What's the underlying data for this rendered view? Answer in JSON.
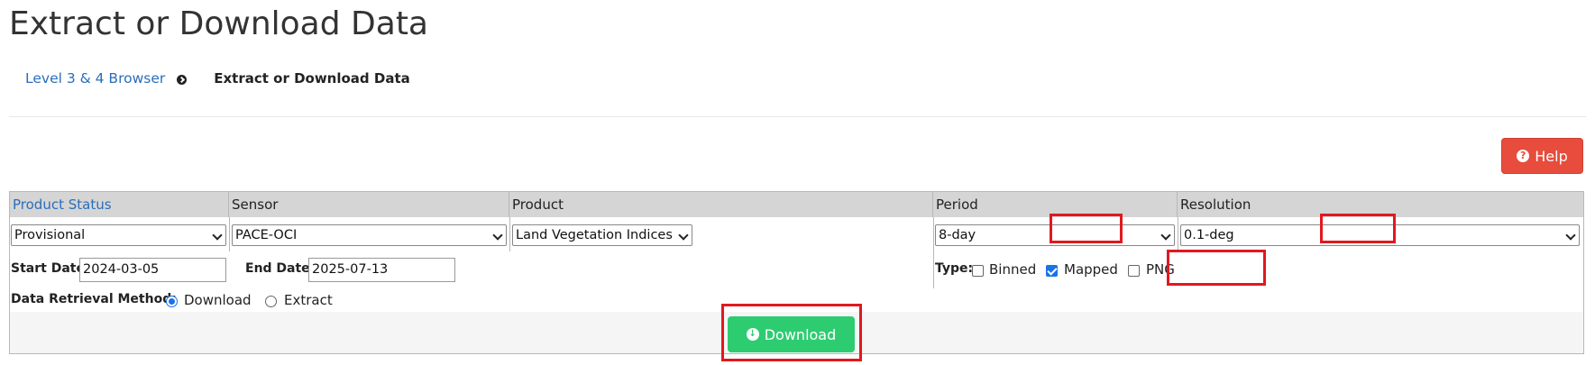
{
  "page": {
    "title": "Extract or Download Data"
  },
  "breadcrumb": {
    "parent": "Level 3 & 4 Browser",
    "current": "Extract or Download Data"
  },
  "help_button": {
    "icon": "question-circle-icon",
    "label": "Help"
  },
  "form": {
    "headers": {
      "product_status": "Product Status",
      "sensor": "Sensor",
      "product": "Product",
      "period": "Period",
      "resolution": "Resolution"
    },
    "selects": {
      "product_status": "Provisional",
      "sensor": "PACE-OCI",
      "product": "Land Vegetation Indices",
      "period": "8-day",
      "resolution": "0.1-deg"
    },
    "start_date": {
      "label": "Start Date:",
      "value": "2024-03-05"
    },
    "end_date": {
      "label": "End Date:",
      "value": "2025-07-13"
    },
    "type": {
      "label": "Type:",
      "options": [
        {
          "label": "Binned",
          "checked": false
        },
        {
          "label": "Mapped",
          "checked": true
        },
        {
          "label": "PNG",
          "checked": false
        }
      ]
    },
    "retrieval": {
      "label": "Data Retrieval Method:",
      "options": [
        {
          "label": "Download",
          "selected": true
        },
        {
          "label": "Extract",
          "selected": false
        }
      ]
    }
  },
  "download_button": {
    "icon": "download-circle-icon",
    "label": "Download"
  },
  "colors": {
    "help_red": "#e74c3c",
    "download_green": "#2ecc71",
    "link_blue": "#2a6ebb",
    "highlight_red": "#e0191f"
  }
}
